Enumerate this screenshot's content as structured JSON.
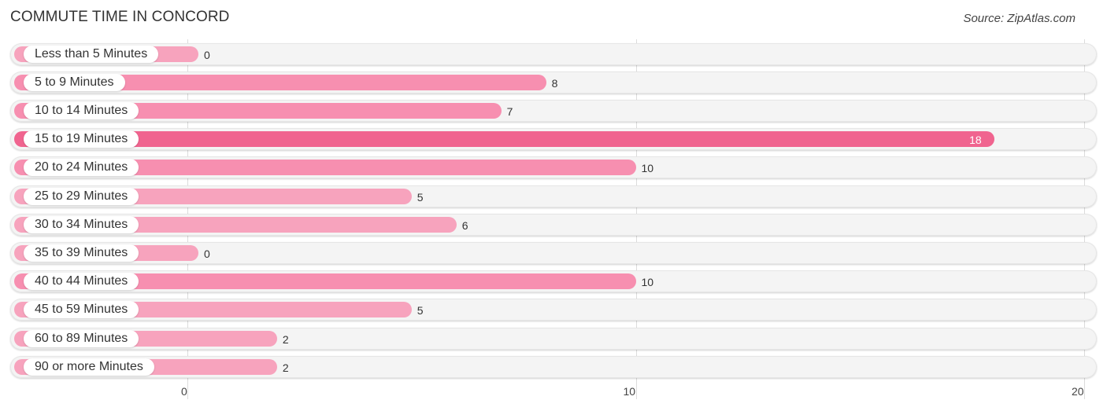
{
  "header": {
    "title": "COMMUTE TIME IN CONCORD",
    "source": "Source: ZipAtlas.com"
  },
  "colors": {
    "bar_normal": "#f78fb0",
    "bar_light": "#f7a3bd",
    "bar_highlight": "#f0648f",
    "row_background": "#f4f4f4"
  },
  "chart_data": {
    "type": "bar",
    "orientation": "horizontal",
    "title": "COMMUTE TIME IN CONCORD",
    "xlabel": "",
    "ylabel": "",
    "xlim": [
      0,
      20
    ],
    "xticks": [
      "0",
      "10",
      "20"
    ],
    "grid": true,
    "categories": [
      "Less than 5 Minutes",
      "5 to 9 Minutes",
      "10 to 14 Minutes",
      "15 to 19 Minutes",
      "20 to 24 Minutes",
      "25 to 29 Minutes",
      "30 to 34 Minutes",
      "35 to 39 Minutes",
      "40 to 44 Minutes",
      "45 to 59 Minutes",
      "60 to 89 Minutes",
      "90 or more Minutes"
    ],
    "values": [
      0,
      8,
      7,
      18,
      10,
      5,
      6,
      0,
      10,
      5,
      2,
      2
    ],
    "value_labels": [
      "0",
      "8",
      "7",
      "18",
      "10",
      "5",
      "6",
      "0",
      "10",
      "5",
      "2",
      "2"
    ],
    "highlight_index": 3
  }
}
